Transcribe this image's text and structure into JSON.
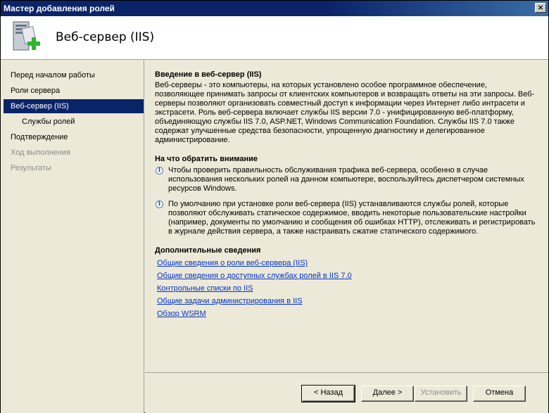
{
  "window": {
    "title": "Мастер добавления ролей",
    "close": "×"
  },
  "header": {
    "title": "Веб-сервер (IIS)",
    "icon": "server-add-icon"
  },
  "nav": {
    "items": [
      {
        "label": "Перед началом работы",
        "state": "normal"
      },
      {
        "label": "Роли сервера",
        "state": "normal"
      },
      {
        "label": "Веб-сервер (IIS)",
        "state": "active"
      },
      {
        "label": "Службы ролей",
        "state": "sub"
      },
      {
        "label": "Подтверждение",
        "state": "normal"
      },
      {
        "label": "Ход выполнения",
        "state": "disabled"
      },
      {
        "label": "Результаты",
        "state": "disabled"
      }
    ]
  },
  "content": {
    "intro_heading": "Введение в веб-сервер (IIS)",
    "intro_text": "Веб-серверы - это компьютеры, на которых установлено особое программное обеспечение, позволяющее принимать запросы от клиентских компьютеров и возвращать ответы на эти запросы. Веб-серверы позволяют организовать совместный доступ к информации через Интернет либо интрасети и экстрасети. Роль веб-сервера включает службы IIS версии 7.0 - унифицированную веб-платформу, объединяющую службы IIS 7.0, ASP.NET, Windows Communication Foundation. Службы IIS 7.0 также содержат улучшенные средства безопасности, упрощенную диагностику и делегированное администрирование.",
    "notes_heading": "На что обратить внимание",
    "notes": [
      "Чтобы проверить правильность обслуживания трафика веб-сервера, особенно в случае использования нескольких ролей на данном компьютере, воспользуйтесь диспетчером системных ресурсов Windows.",
      "По умолчанию при установке роли веб-сервера (IIS) устанавливаются службы ролей, которые позволяют обслуживать статическое содержимое, вводить некоторые пользовательские настройки (например, документы по умолчанию и сообщения об ошибках HTTP), отслеживать и регистрировать в журнале действия сервера, а также настраивать сжатие статического содержимого."
    ],
    "info_glyph": "i",
    "more_heading": "Дополнительные сведения",
    "links": [
      "Общие сведения о роли веб-сервера (IIS)",
      "Общие сведения о доступных службах ролей в IIS 7.0",
      "Контрольные списки по IIS",
      "Общие задачи администрирования в IIS",
      "Обзор WSRM"
    ]
  },
  "buttons": {
    "back": "< Назад",
    "next": "Далее >",
    "install": "Установить",
    "cancel": "Отмена"
  },
  "colors": {
    "title_bar": "#0a246a",
    "selection": "#0a246a",
    "link": "#0033cc"
  }
}
